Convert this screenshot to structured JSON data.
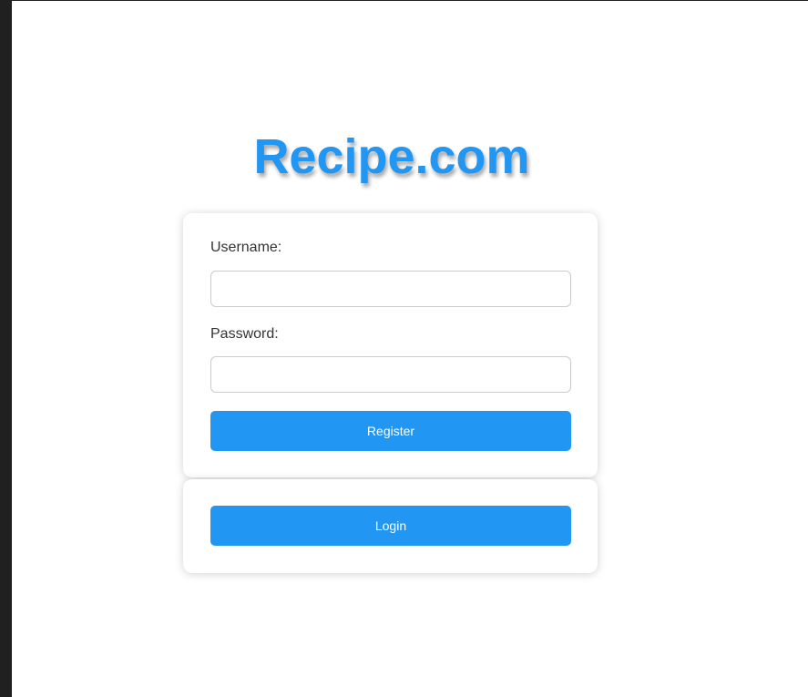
{
  "brand": {
    "title": "Recipe.com",
    "color": "#2196f3"
  },
  "register_form": {
    "username_label": "Username:",
    "username_value": "",
    "password_label": "Password:",
    "password_value": "",
    "register_button": "Register"
  },
  "login_panel": {
    "login_button": "Login"
  },
  "colors": {
    "accent": "#2196f3",
    "page_background": "#ffffff",
    "window_frame": "#202020"
  }
}
